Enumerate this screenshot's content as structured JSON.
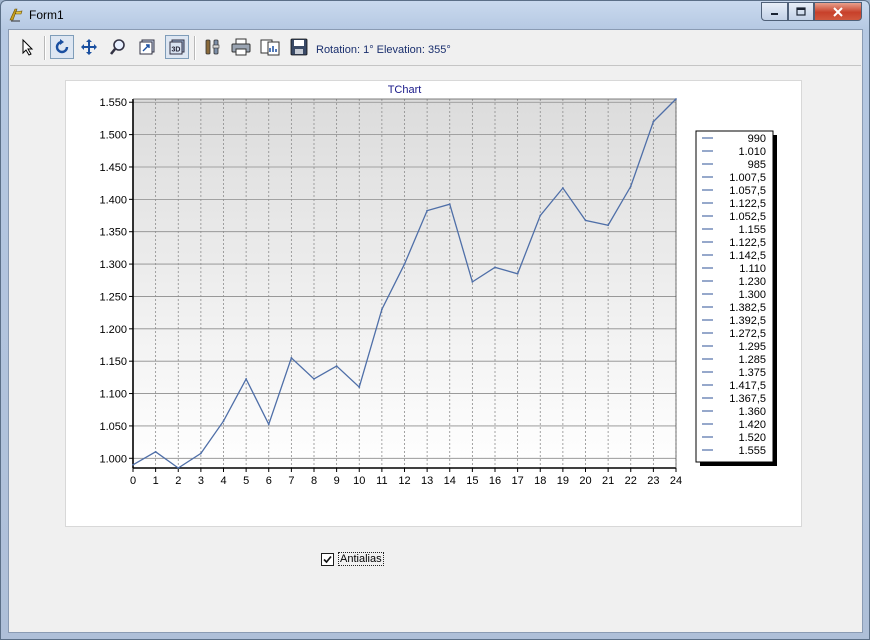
{
  "window": {
    "title": "Form1"
  },
  "toolbar": {
    "buttons": [
      {
        "name": "select-pointer",
        "icon": "pointer-icon"
      },
      {
        "name": "rotate",
        "icon": "rotate-icon"
      },
      {
        "name": "move",
        "icon": "move-icon"
      },
      {
        "name": "zoom",
        "icon": "zoom-icon"
      },
      {
        "name": "depth",
        "icon": "depth-icon"
      },
      {
        "name": "view-3d",
        "icon": "3d-icon"
      },
      {
        "name": "edit",
        "icon": "edit-icon"
      },
      {
        "name": "print",
        "icon": "print-icon"
      },
      {
        "name": "copy",
        "icon": "copy-icon"
      },
      {
        "name": "save",
        "icon": "save-icon"
      }
    ],
    "status_text": "Rotation: 1° Elevation: 355°"
  },
  "checkbox": {
    "label": "Antialias",
    "checked": true
  },
  "chart_data": {
    "type": "line",
    "title": "TChart",
    "x": [
      0,
      1,
      2,
      3,
      4,
      5,
      6,
      7,
      8,
      9,
      10,
      11,
      12,
      13,
      14,
      15,
      16,
      17,
      18,
      19,
      20,
      21,
      22,
      23,
      24
    ],
    "series": [
      {
        "values": [
          990,
          1010,
          985,
          1007.5,
          1057.5,
          1122.5,
          1052.5,
          1155,
          1122.5,
          1142.5,
          1110,
          1230,
          1300,
          1382.5,
          1392.5,
          1272.5,
          1295,
          1285,
          1375,
          1417.5,
          1367.5,
          1360,
          1420,
          1520,
          1555
        ],
        "color": "#4f6fa8"
      }
    ],
    "legend_labels": [
      "990",
      "1.010",
      "985",
      "1.007,5",
      "1.057,5",
      "1.122,5",
      "1.052,5",
      "1.155",
      "1.122,5",
      "1.142,5",
      "1.110",
      "1.230",
      "1.300",
      "1.382,5",
      "1.392,5",
      "1.272,5",
      "1.295",
      "1.285",
      "1.375",
      "1.417,5",
      "1.367,5",
      "1.360",
      "1.420",
      "1.520",
      "1.555"
    ],
    "y_ticks": [
      1000,
      1050,
      1100,
      1150,
      1200,
      1250,
      1300,
      1350,
      1400,
      1450,
      1500,
      1550
    ],
    "y_tick_labels": [
      "1.000",
      "1.050",
      "1.100",
      "1.150",
      "1.200",
      "1.250",
      "1.300",
      "1.350",
      "1.400",
      "1.450",
      "1.500",
      "1.550"
    ],
    "x_tick_labels": [
      "0",
      "1",
      "2",
      "3",
      "4",
      "5",
      "6",
      "7",
      "8",
      "9",
      "10",
      "11",
      "12",
      "13",
      "14",
      "15",
      "16",
      "17",
      "18",
      "19",
      "20",
      "21",
      "22",
      "23",
      "24"
    ],
    "xlim": [
      0,
      24
    ],
    "ylim": [
      985,
      1555
    ],
    "grid": true,
    "legend_placement": "right"
  }
}
